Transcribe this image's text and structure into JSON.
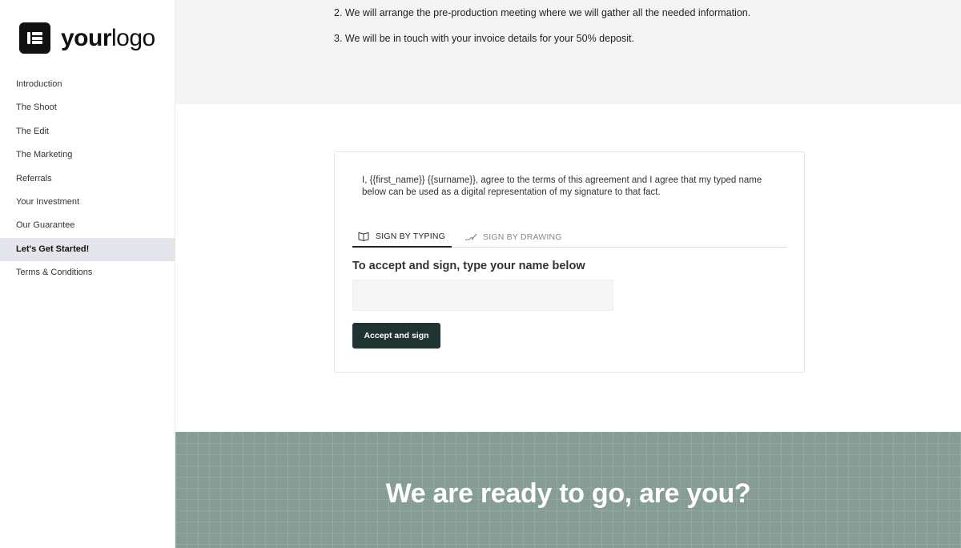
{
  "logo": {
    "bold": "your",
    "light": "logo",
    "icon": "logo-icon"
  },
  "sidebar": {
    "items": [
      {
        "label": "Introduction"
      },
      {
        "label": "The Shoot"
      },
      {
        "label": "The Edit"
      },
      {
        "label": "The Marketing"
      },
      {
        "label": "Referrals"
      },
      {
        "label": "Your Investment"
      },
      {
        "label": "Our Guarantee"
      },
      {
        "label": "Let's Get Started!",
        "active": true
      },
      {
        "label": "Terms & Conditions"
      }
    ]
  },
  "steps": {
    "step2": "2. We will arrange the pre-production meeting where we will gather all the needed information.",
    "step3": "3. We will be in touch with your invoice details for your 50% deposit."
  },
  "signature": {
    "agreement": "I, {{first_name}} {{surname}}, agree to the terms of this agreement and I agree that my typed name below can be used as a digital representation of my signature to that fact.",
    "tabs": [
      {
        "label": "SIGN BY TYPING",
        "icon": "keyboard-icon",
        "active": true
      },
      {
        "label": "SIGN BY DRAWING",
        "icon": "pen-icon",
        "active": false
      }
    ],
    "title": "To accept and sign, type your name below",
    "input_value": "",
    "input_placeholder": "",
    "button_label": "Accept and sign"
  },
  "banner": {
    "title": "We are ready to go, are you?"
  },
  "colors": {
    "accent": "#1f3432",
    "banner": "#869d94",
    "active_nav": "#e3e5ea",
    "top_band": "#f4f4f4"
  }
}
